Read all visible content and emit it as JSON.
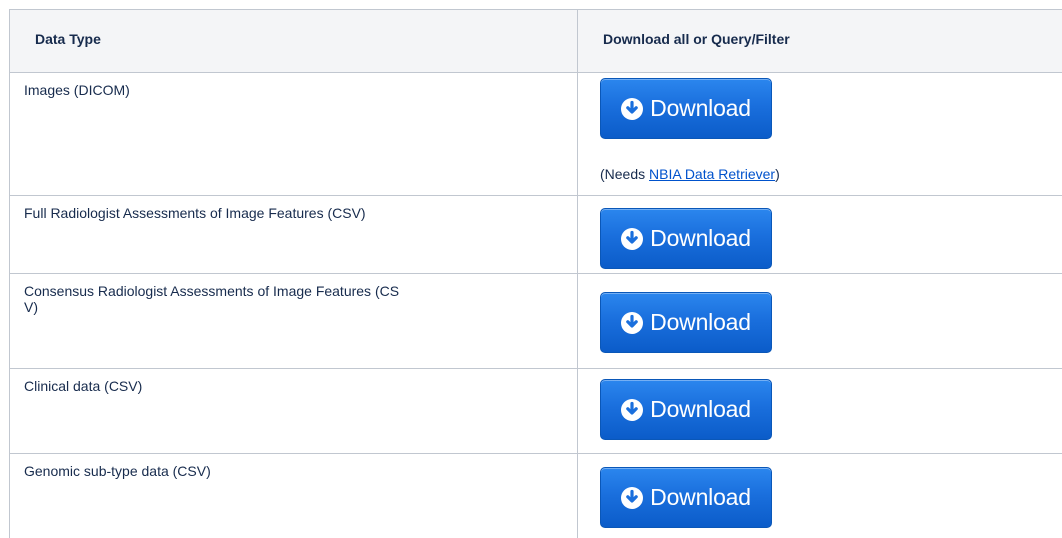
{
  "table": {
    "headers": [
      "Data Type",
      "Download all or Query/Filter"
    ],
    "rows": [
      {
        "data_type": "Images (DICOM)",
        "button_label": "Download",
        "note_prefix": "(Needs ",
        "note_link": "NBIA Data Retriever",
        "note_suffix": ")"
      },
      {
        "data_type": "Full Radiologist Assessments of Image Features  (CSV)",
        "button_label": "Download"
      },
      {
        "data_type": "Consensus Radiologist Assessments of Image Features  (CS\nV)",
        "button_label": "Download"
      },
      {
        "data_type": "Clinical data (CSV)",
        "button_label": "Download"
      },
      {
        "data_type": "Genomic sub-type data (CSV)",
        "button_label": "Download"
      }
    ]
  },
  "icons": {
    "download": "download-circle-arrow-icon"
  },
  "colors": {
    "button": "#1a6fdd",
    "link": "#0052cc",
    "header_bg": "#f4f5f7",
    "border": "#c1c7d0"
  }
}
